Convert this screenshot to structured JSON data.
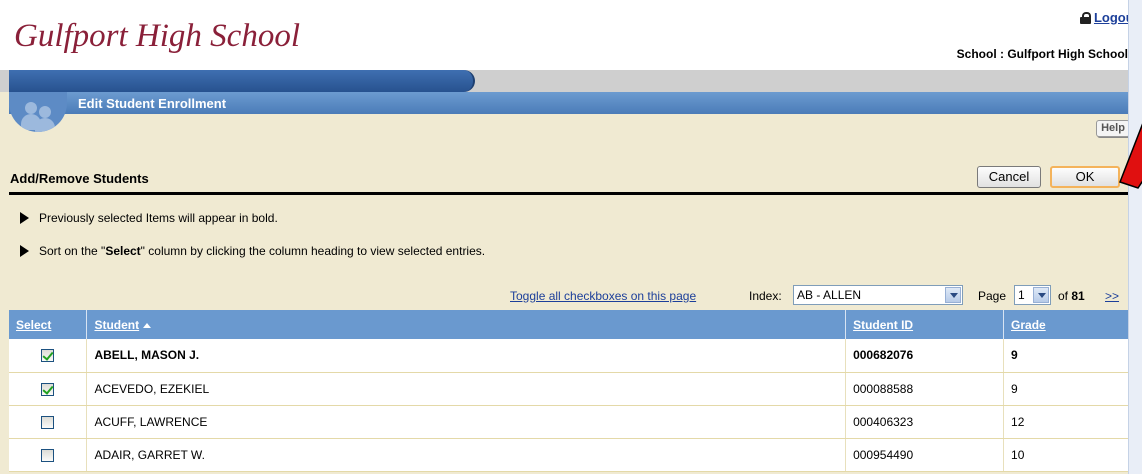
{
  "header": {
    "school_title": "Gulfport High School",
    "logout_label": "Logout",
    "school_label": "School : Gulfport High School"
  },
  "page": {
    "title": "Edit Student Enrollment",
    "help_label": "Help",
    "section_title": "Add/Remove Students",
    "cancel_label": "Cancel",
    "ok_label": "OK"
  },
  "notes": {
    "note1": "Previously selected Items will appear in bold.",
    "note2_prefix": "Sort on the \"",
    "note2_bold": "Select",
    "note2_suffix": "\" column by clicking the column heading to view selected entries."
  },
  "pager": {
    "toggle_label": "Toggle all checkboxes on this page",
    "index_label": "Index:",
    "index_value": "AB - ALLEN",
    "page_label": "Page",
    "page_value": "1",
    "of_prefix": "of",
    "total_pages": "81",
    "next_label": ">>"
  },
  "table": {
    "columns": {
      "select": "Select",
      "student": "Student",
      "student_id": "Student ID",
      "grade": "Grade"
    },
    "rows": [
      {
        "name": "ABELL, MASON J.",
        "id": "000682076",
        "grade": "9",
        "checked": true,
        "bold": true
      },
      {
        "name": "ACEVEDO, EZEKIEL",
        "id": "000088588",
        "grade": "9",
        "checked": true,
        "bold": false
      },
      {
        "name": "ACUFF, LAWRENCE",
        "id": "000406323",
        "grade": "12",
        "checked": false,
        "bold": false
      },
      {
        "name": "ADAIR, GARRET W.",
        "id": "000954490",
        "grade": "10",
        "checked": false,
        "bold": false
      }
    ]
  },
  "colors": {
    "brand_maroon": "#8a2039",
    "header_blue": "#6a99cf",
    "background_tan": "#f0ead2",
    "link_blue": "#1c3f9a",
    "annotation_red": "#e01010"
  },
  "icons": [
    "lock-icon",
    "students-icon",
    "bullet-triangle-icon",
    "sort-ascending-icon",
    "dropdown-arrow-icon",
    "checkbox-checked-icon",
    "red-arrow-annotation"
  ]
}
